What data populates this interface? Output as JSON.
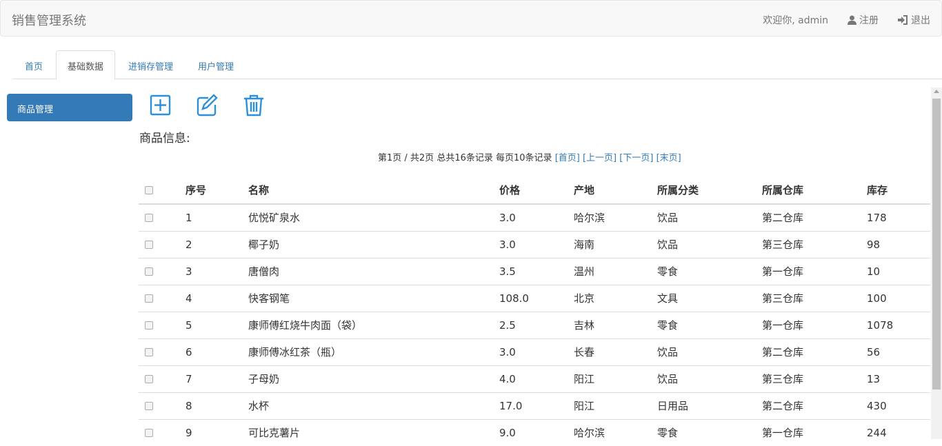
{
  "navbar": {
    "brand": "销售管理系统",
    "welcome": "欢迎你, admin",
    "register": "注册",
    "logout": "退出"
  },
  "tabs": [
    {
      "label": "首页",
      "active": false
    },
    {
      "label": "基础数据",
      "active": true
    },
    {
      "label": "进销存管理",
      "active": false
    },
    {
      "label": "用户管理",
      "active": false
    }
  ],
  "sidebar": {
    "items": [
      {
        "label": "商品管理"
      }
    ]
  },
  "toolbar": {
    "add_icon": "plus-square-icon",
    "edit_icon": "pencil-square-icon",
    "delete_icon": "trash-icon",
    "color": "#2d8fd5"
  },
  "section": {
    "title": "商品信息:"
  },
  "pager": {
    "summary": "第1页 / 共2页  总共16条记录 每页10条记录",
    "first": "[首页]",
    "prev": "[上一页]",
    "next": "[下一页]",
    "last": "[末页]"
  },
  "table": {
    "headers": [
      "序号",
      "名称",
      "价格",
      "产地",
      "所属分类",
      "所属仓库",
      "库存"
    ],
    "rows": [
      [
        "1",
        "优悦矿泉水",
        "3.0",
        "哈尔滨",
        "饮品",
        "第二仓库",
        "178"
      ],
      [
        "2",
        "椰子奶",
        "3.0",
        "海南",
        "饮品",
        "第三仓库",
        "98"
      ],
      [
        "3",
        "唐僧肉",
        "3.5",
        "温州",
        "零食",
        "第一仓库",
        "10"
      ],
      [
        "4",
        "快客钢笔",
        "108.0",
        "北京",
        "文具",
        "第三仓库",
        "100"
      ],
      [
        "5",
        "康师傅红烧牛肉面（袋）",
        "2.5",
        "吉林",
        "零食",
        "第一仓库",
        "1078"
      ],
      [
        "6",
        "康师傅冰红茶（瓶）",
        "3.0",
        "长春",
        "饮品",
        "第二仓库",
        "56"
      ],
      [
        "7",
        "子母奶",
        "4.0",
        "阳江",
        "饮品",
        "第三仓库",
        "13"
      ],
      [
        "8",
        "水杯",
        "17.0",
        "阳江",
        "日用品",
        "第二仓库",
        "430"
      ],
      [
        "9",
        "可比克薯片",
        "9.0",
        "哈尔滨",
        "零食",
        "第一仓库",
        "244"
      ]
    ]
  }
}
